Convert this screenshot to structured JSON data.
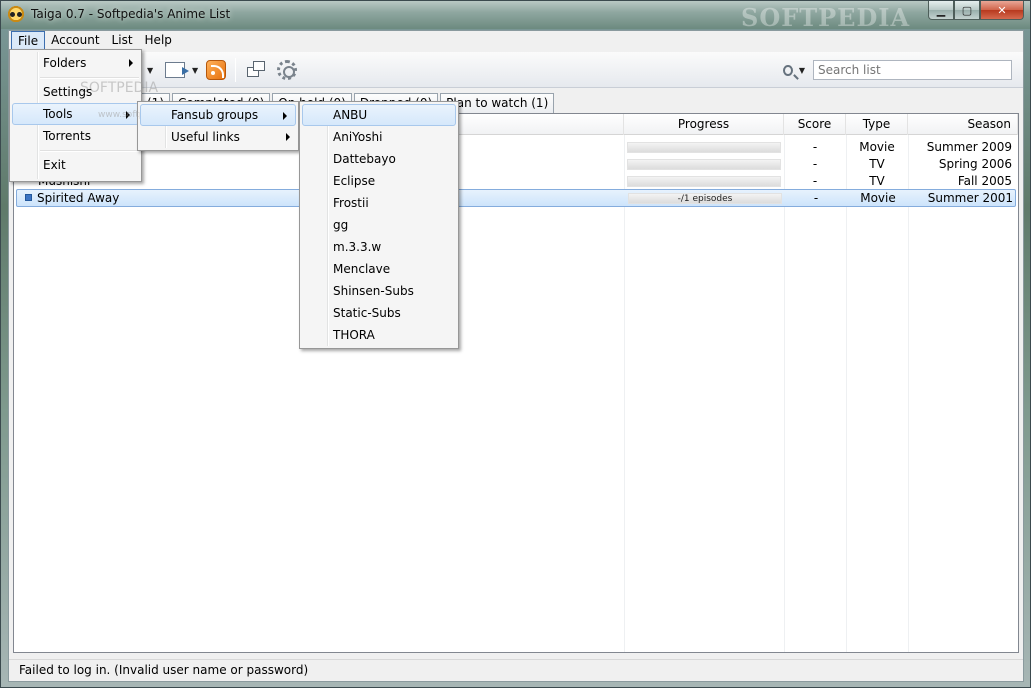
{
  "window": {
    "title": "Taiga 0.7 - Softpedia's Anime List",
    "watermark": "SOFTPEDIA",
    "minimize_glyph": "▁",
    "maximize_glyph": "▢",
    "close_glyph": "✕"
  },
  "menubar": {
    "items": [
      "File",
      "Account",
      "List",
      "Help"
    ]
  },
  "file_menu": {
    "items": [
      "Folders",
      "Settings",
      "Tools",
      "Torrents",
      "Exit"
    ]
  },
  "tools_menu": {
    "items": [
      "Fansub groups",
      "Useful links"
    ]
  },
  "fansub_menu": {
    "items": [
      "ANBU",
      "AniYoshi",
      "Dattebayo",
      "Eclipse",
      "Frostii",
      "gg",
      "m.3.3.w",
      "Menclave",
      "Shinsen-Subs",
      "Static-Subs",
      "THORA"
    ]
  },
  "menu_watermarks": {
    "file": "SOFTPEDIA",
    "tools": "www.softpedia.com"
  },
  "search": {
    "placeholder": "Search list"
  },
  "tabs": {
    "visible": [
      "(1)",
      "Completed (0)",
      "On hold (0)",
      "Dropped (0)",
      "Plan to watch (1)"
    ]
  },
  "list": {
    "columns": [
      "Progress",
      "Score",
      "Type",
      "Season"
    ],
    "rows": [
      {
        "title": "",
        "progress": "",
        "score": "-",
        "type": "Movie",
        "season": "Summer 2009"
      },
      {
        "title": "",
        "progress": "",
        "score": "-",
        "type": "TV",
        "season": "Spring 2006"
      },
      {
        "title": "Mushishi",
        "progress": "",
        "score": "-",
        "type": "TV",
        "season": "Fall 2005"
      },
      {
        "title": "Spirited Away",
        "progress": "-/1 episodes",
        "score": "-",
        "type": "Movie",
        "season": "Summer 2001"
      }
    ]
  },
  "status": {
    "text": "Failed to log in. (Invalid user name or password)"
  },
  "colors": {
    "menu_highlight": "#d6e8fb",
    "selection": "#cde4fb",
    "rss": "#e6700d"
  }
}
